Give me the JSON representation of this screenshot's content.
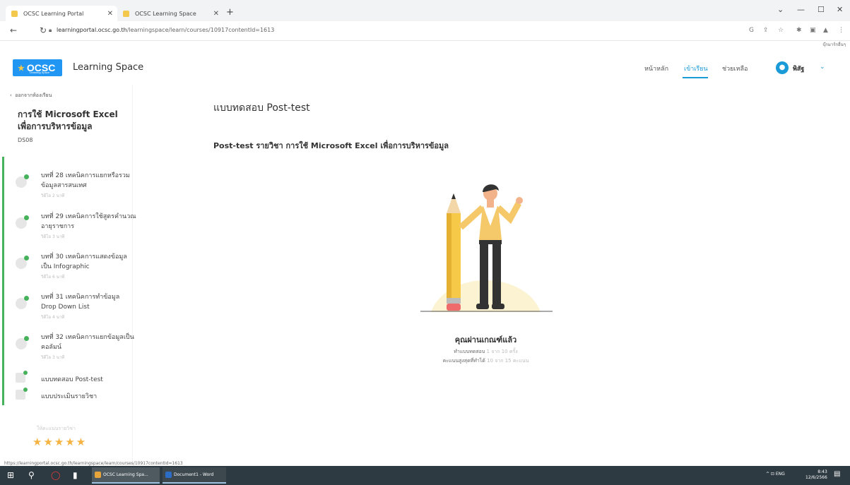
{
  "browser": {
    "tabs": [
      {
        "label": "OCSC Learning Portal",
        "active": true
      },
      {
        "label": "OCSC Learning Space",
        "active": false
      }
    ],
    "new_tab": "+",
    "url_host": "learningportal.ocsc.go.th",
    "url_path": "/learningspace/learn/courses/10917contentId=1613",
    "bookmark": "บุ๊กมาร์กอื่นๆ",
    "status_url": "https://learningportal.ocsc.go.th/learningspace/learn/courses/10917contentId=1613"
  },
  "header": {
    "logo_text": "OCSC",
    "logo_sub": "Learning Space",
    "brand": "Learning Space",
    "nav": [
      "หน้าหลัก",
      "เข้าเรียน",
      "ช่วยเหลือ"
    ],
    "user_name": "พิสัฐ",
    "colors": {
      "accent": "#1a9bd7",
      "logo_bg": "#2196f3",
      "progress": "#46b25b"
    }
  },
  "sidebar": {
    "back_label": "ออกจากห้องเรียน",
    "course_title": "การใช้ Microsoft Excel เพื่อการบริหารข้อมูล",
    "course_code": "DS08",
    "lessons": [
      {
        "title": "บทที่ 28 เทคนิคการแยกหรือรวมข้อมูลสารสนเทศ",
        "duration": "วิดีโอ 2 นาที",
        "icon": "play-check-icon"
      },
      {
        "title": "บทที่ 29 เทคนิคการใช้สูตรคำนวณอายุราชการ",
        "duration": "วิดีโอ 3 นาที",
        "icon": "play-check-icon"
      },
      {
        "title": "บทที่ 30 เทคนิคการแสดงข้อมูลเป็น Infographic",
        "duration": "วิดีโอ 6 นาที",
        "icon": "play-check-icon"
      },
      {
        "title": "บทที่ 31 เทคนิคการทำข้อมูล Drop Down List",
        "duration": "วิดีโอ 4 นาที",
        "icon": "play-check-icon"
      },
      {
        "title": "บทที่ 32 เทคนิคการแยกข้อมูลเป็นคอลัมน์",
        "duration": "วิดีโอ 3 นาที",
        "icon": "play-check-icon"
      }
    ],
    "extras": [
      {
        "label": "แบบทดสอบ Post-test",
        "icon": "quiz-check-icon"
      },
      {
        "label": "แบบประเมินรายวิชา",
        "icon": "thumbs-up-check-icon"
      }
    ],
    "rate_label": "ให้คะแนนรายวิชา",
    "stars": "★★★★★",
    "rating": 5
  },
  "main": {
    "heading": "แบบทดสอบ Post-test",
    "subheading": "Post-test รายวิชา การใช้ Microsoft Excel เพื่อการบริหารข้อมูล",
    "result": "คุณผ่านเกณฑ์แล้ว",
    "attempts_label": "ทำแบบทดสอบ",
    "attempts_value": "1 จาก 10 ครั้ง",
    "score_label": "คะแนนสูงสุดที่ทำได้",
    "score_value": "10 จาก 15 คะแนน"
  },
  "taskbar": {
    "apps": [
      {
        "label": "OCSC Learning Spa..."
      },
      {
        "label": "Document1 - Word"
      }
    ],
    "tray": "^ ⊡ ENG",
    "time": "8:43",
    "date": "12/6/2566"
  }
}
